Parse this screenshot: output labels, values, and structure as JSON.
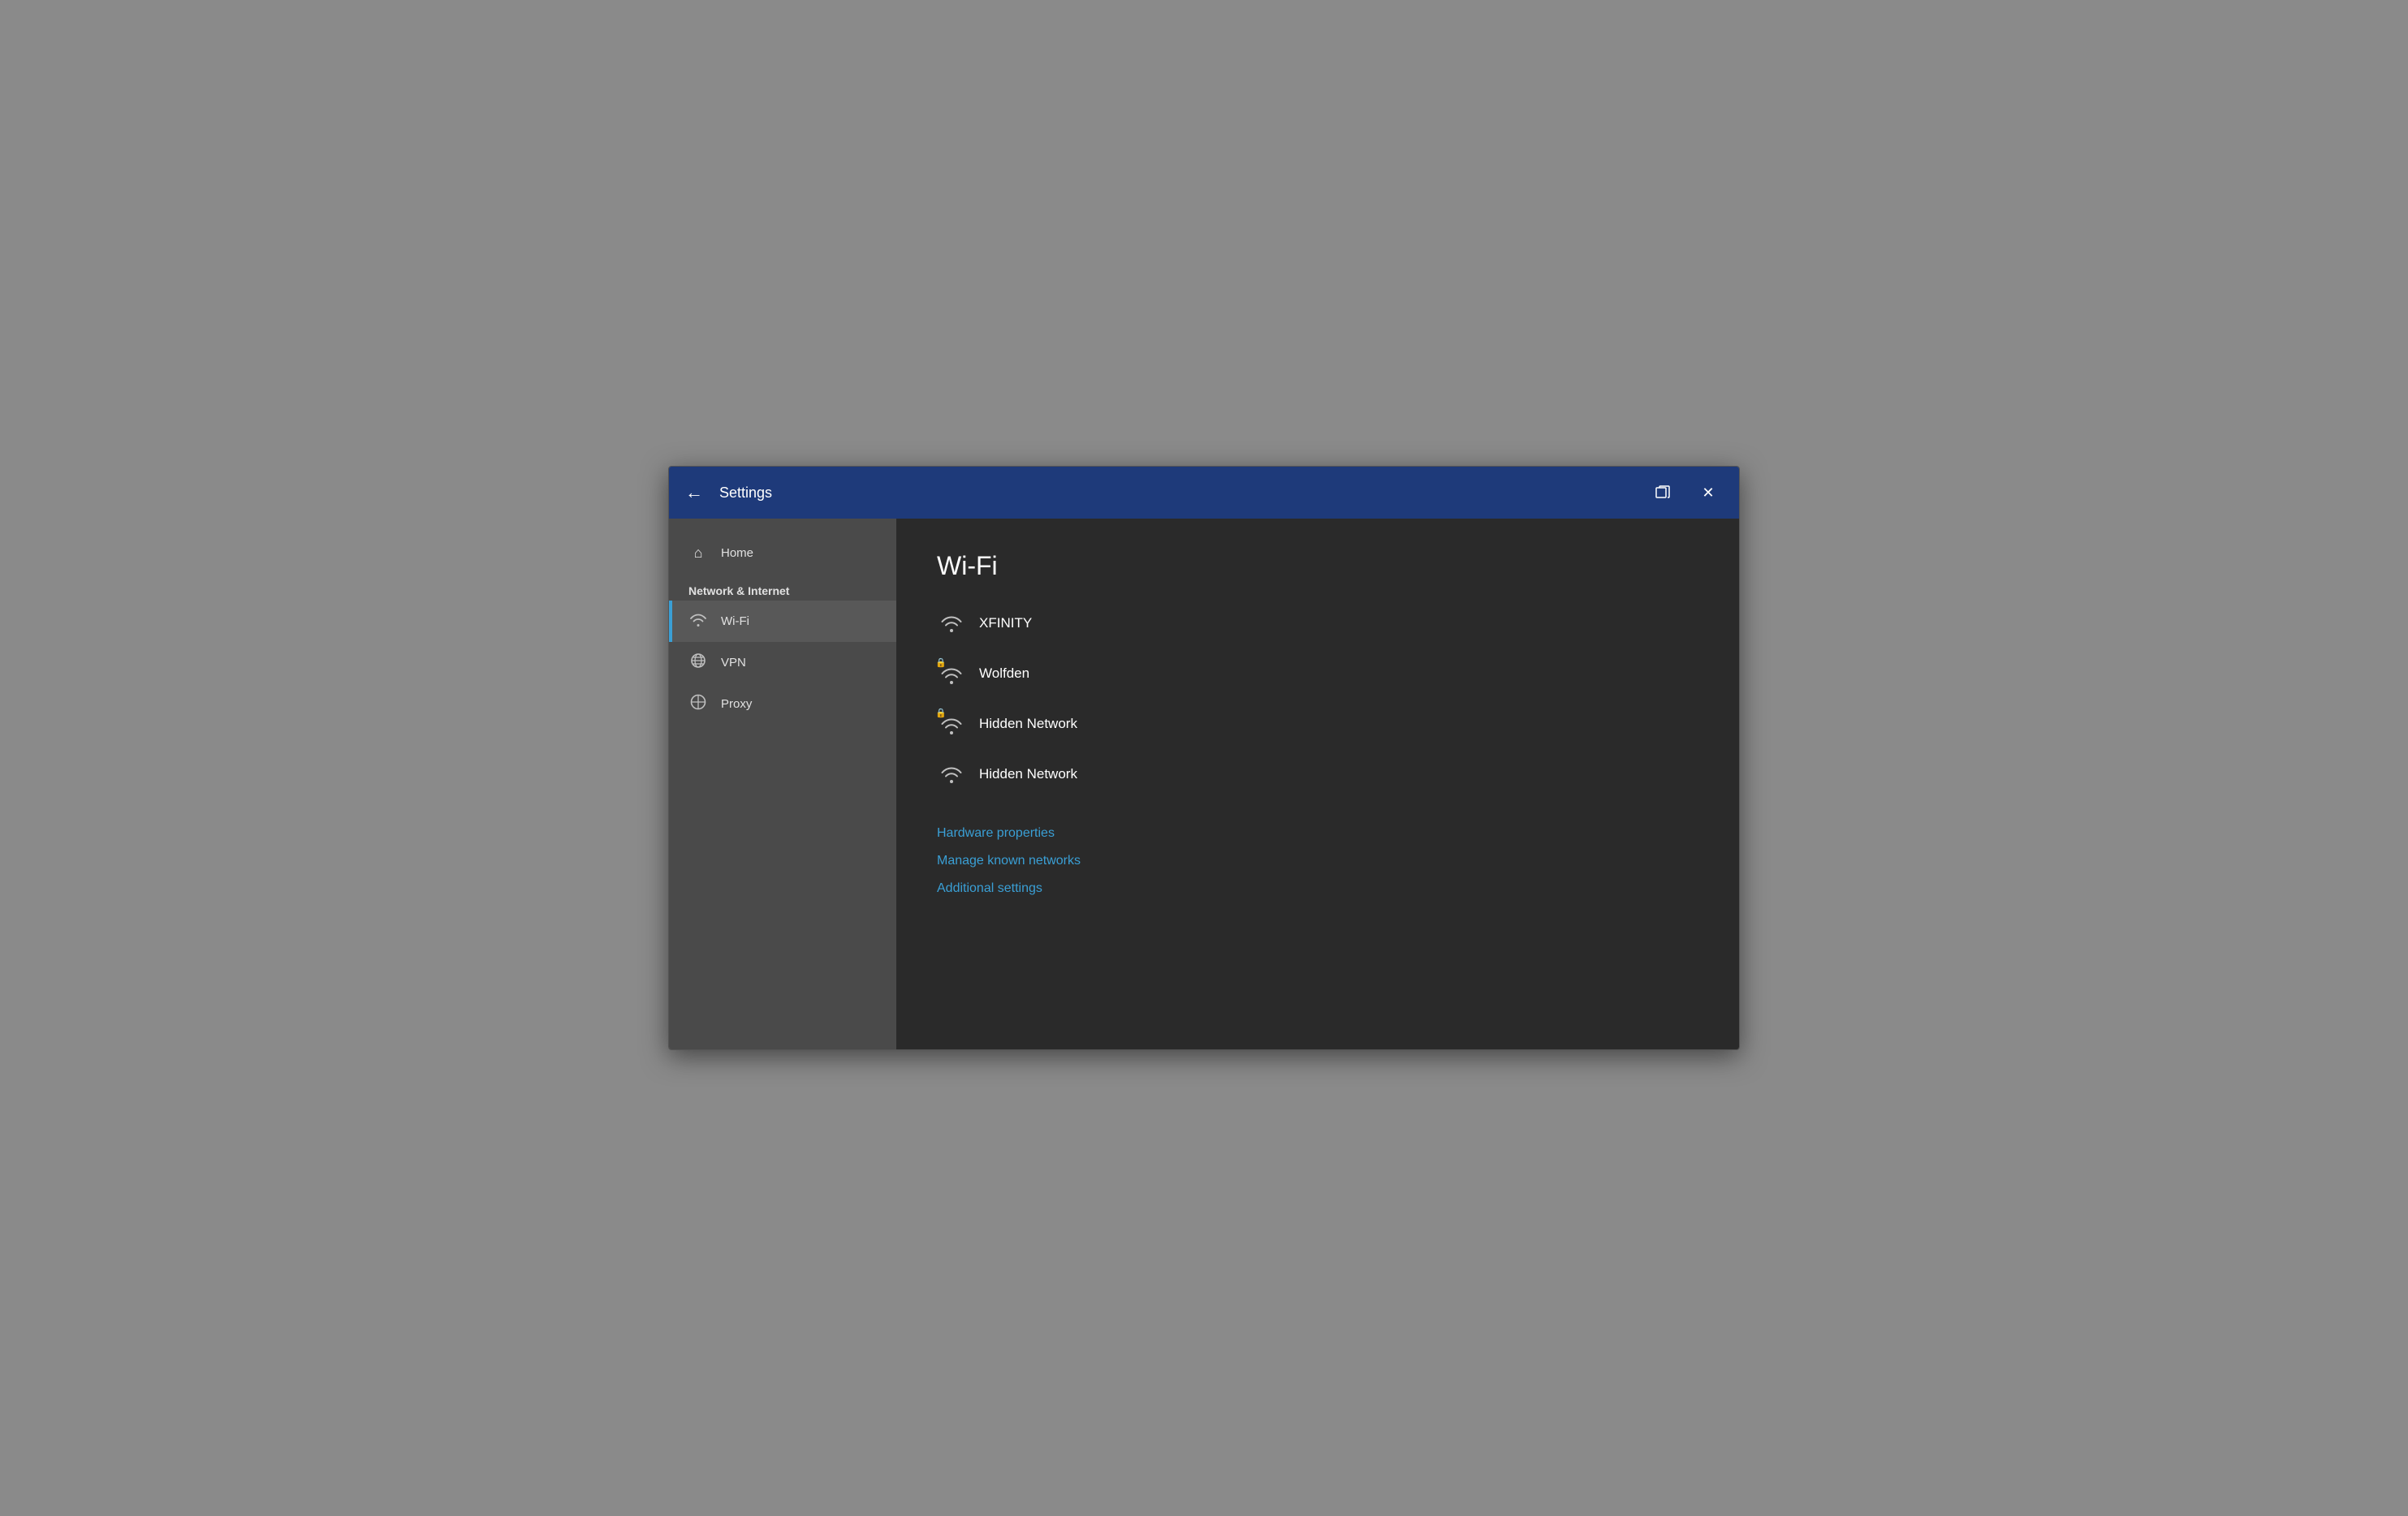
{
  "titlebar": {
    "back_label": "←",
    "title": "Settings",
    "restore_label": "❐",
    "close_label": "✕"
  },
  "sidebar": {
    "home_label": "Home",
    "section_label": "Network & Internet",
    "items": [
      {
        "id": "wifi",
        "label": "Wi-Fi",
        "icon": "wifi",
        "active": true
      },
      {
        "id": "vpn",
        "label": "VPN",
        "icon": "vpn",
        "active": false
      },
      {
        "id": "proxy",
        "label": "Proxy",
        "icon": "proxy",
        "active": false
      }
    ]
  },
  "main": {
    "page_title": "Wi-Fi",
    "networks": [
      {
        "name": "XFINITY",
        "secured": false
      },
      {
        "name": "Wolfden",
        "secured": true
      },
      {
        "name": "Hidden Network",
        "secured": true
      },
      {
        "name": "Hidden Network",
        "secured": false
      }
    ],
    "links": [
      {
        "label": "Hardware properties"
      },
      {
        "label": "Manage known networks"
      },
      {
        "label": "Additional settings"
      }
    ]
  }
}
